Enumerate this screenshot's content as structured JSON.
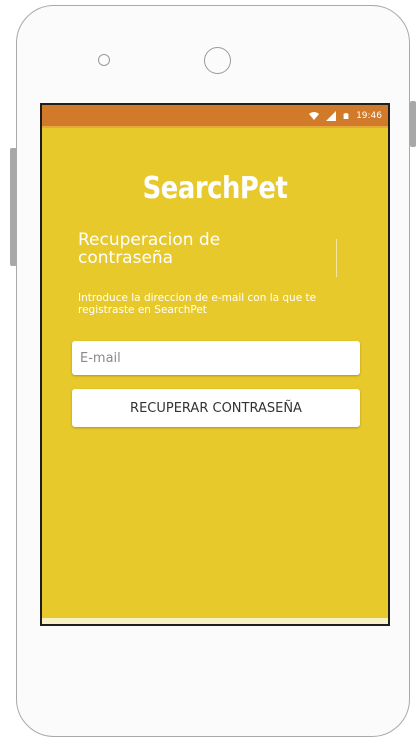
{
  "status_bar": {
    "time": "19:46",
    "icons": [
      "wifi-icon",
      "signal-icon",
      "battery-icon"
    ],
    "color": "#d17a2a"
  },
  "app": {
    "title": "SearchPet",
    "background_color": "#e8c92c"
  },
  "recovery": {
    "heading": "Recuperacion de contraseña",
    "instructions": "Introduce la direccion de e-mail con la que te registraste en SearchPet",
    "email_placeholder": "E-mail",
    "email_value": "",
    "button_label": "RECUPERAR CONTRASEÑA"
  }
}
